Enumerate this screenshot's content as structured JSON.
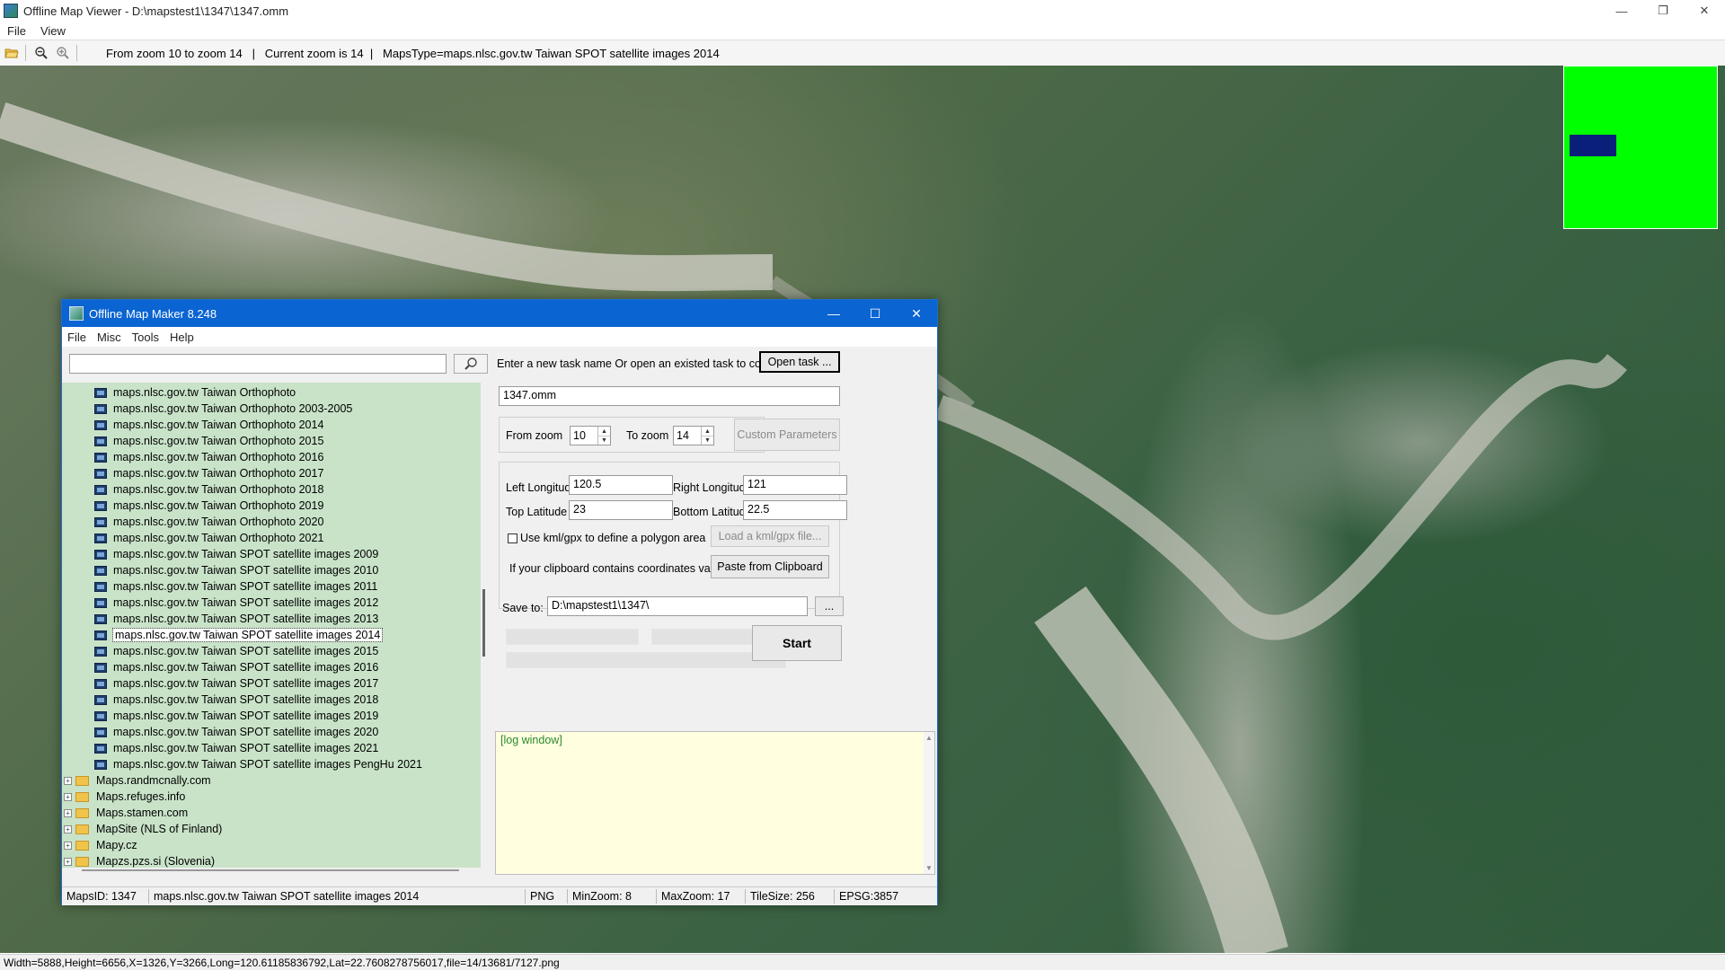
{
  "viewer": {
    "title": "Offline Map Viewer - D:\\mapstest1\\1347\\1347.omm",
    "menu": [
      "File",
      "View"
    ],
    "toolbar_info": "From zoom 10 to zoom 14   |   Current zoom is 14  |   MapsType=maps.nlsc.gov.tw Taiwan SPOT satellite images 2014",
    "status": "Width=5888,Height=6656,X=1326,Y=3266,Long=120.61185836792,Lat=22.7608278756017,file=14/13681/7127.png",
    "icons": [
      "open-folder-icon",
      "zoom-out-icon",
      "zoom-in-icon"
    ],
    "minimap_color": "#00ff00"
  },
  "dialog": {
    "title": "Offline Map Maker 8.248",
    "menu": [
      "File",
      "Misc",
      "Tools",
      "Help"
    ],
    "search_value": "",
    "tree_children": [
      "maps.nlsc.gov.tw Taiwan Orthophoto",
      "maps.nlsc.gov.tw Taiwan Orthophoto 2003-2005",
      "maps.nlsc.gov.tw Taiwan Orthophoto 2014",
      "maps.nlsc.gov.tw Taiwan Orthophoto 2015",
      "maps.nlsc.gov.tw Taiwan Orthophoto 2016",
      "maps.nlsc.gov.tw Taiwan Orthophoto 2017",
      "maps.nlsc.gov.tw Taiwan Orthophoto 2018",
      "maps.nlsc.gov.tw Taiwan Orthophoto 2019",
      "maps.nlsc.gov.tw Taiwan Orthophoto 2020",
      "maps.nlsc.gov.tw Taiwan Orthophoto 2021",
      "maps.nlsc.gov.tw Taiwan SPOT satellite images 2009",
      "maps.nlsc.gov.tw Taiwan SPOT satellite images 2010",
      "maps.nlsc.gov.tw Taiwan SPOT satellite images 2011",
      "maps.nlsc.gov.tw Taiwan SPOT satellite images 2012",
      "maps.nlsc.gov.tw Taiwan SPOT satellite images 2013",
      "maps.nlsc.gov.tw Taiwan SPOT satellite images 2014",
      "maps.nlsc.gov.tw Taiwan SPOT satellite images 2015",
      "maps.nlsc.gov.tw Taiwan SPOT satellite images 2016",
      "maps.nlsc.gov.tw Taiwan SPOT satellite images 2017",
      "maps.nlsc.gov.tw Taiwan SPOT satellite images 2018",
      "maps.nlsc.gov.tw Taiwan SPOT satellite images 2019",
      "maps.nlsc.gov.tw Taiwan SPOT satellite images 2020",
      "maps.nlsc.gov.tw Taiwan SPOT satellite images 2021",
      "maps.nlsc.gov.tw Taiwan SPOT satellite images PengHu 2021"
    ],
    "selected_child": "maps.nlsc.gov.tw Taiwan SPOT satellite images 2014",
    "tree_folders": [
      "Maps.randmcnally.com",
      "Maps.refuges.info",
      "Maps.stamen.com",
      "MapSite (NLS of Finland)",
      "Mapy.cz",
      "Mapzs.pzs.si (Slovenia)"
    ],
    "task_prompt": "Enter a new task name Or open an existed task to continue:",
    "open_task_label": "Open task ...",
    "task_name": "1347.omm",
    "from_zoom_label": "From zoom",
    "from_zoom": "10",
    "to_zoom_label": "To zoom",
    "to_zoom": "14",
    "custom_params_label": "Custom Parameters",
    "left_lon_label": "Left Longitude",
    "left_lon": "120.5",
    "right_lon_label": "Right Longitude",
    "right_lon": "121",
    "top_lat_label": "Top Latitude",
    "top_lat": "23",
    "bottom_lat_label": "Bottom Latitude",
    "bottom_lat": "22.5",
    "kml_label": "Use kml/gpx to define a polygon area",
    "load_kml_label": "Load a kml/gpx file...",
    "clipboard_prompt": "If your clipboard contains coordinates values:",
    "paste_label": "Paste from Clipboard",
    "save_to_label": "Save to:",
    "save_to": "D:\\mapstest1\\1347\\",
    "browse_label": "...",
    "start_label": "Start",
    "log_text": "[log window]",
    "status": {
      "maps_id": "MapsID: 1347",
      "maps_name": "maps.nlsc.gov.tw Taiwan SPOT satellite images 2014",
      "format": "PNG",
      "min_zoom": "MinZoom: 8",
      "max_zoom": "MaxZoom: 17",
      "tile_size": "TileSize: 256",
      "epsg": "EPSG:3857"
    }
  }
}
